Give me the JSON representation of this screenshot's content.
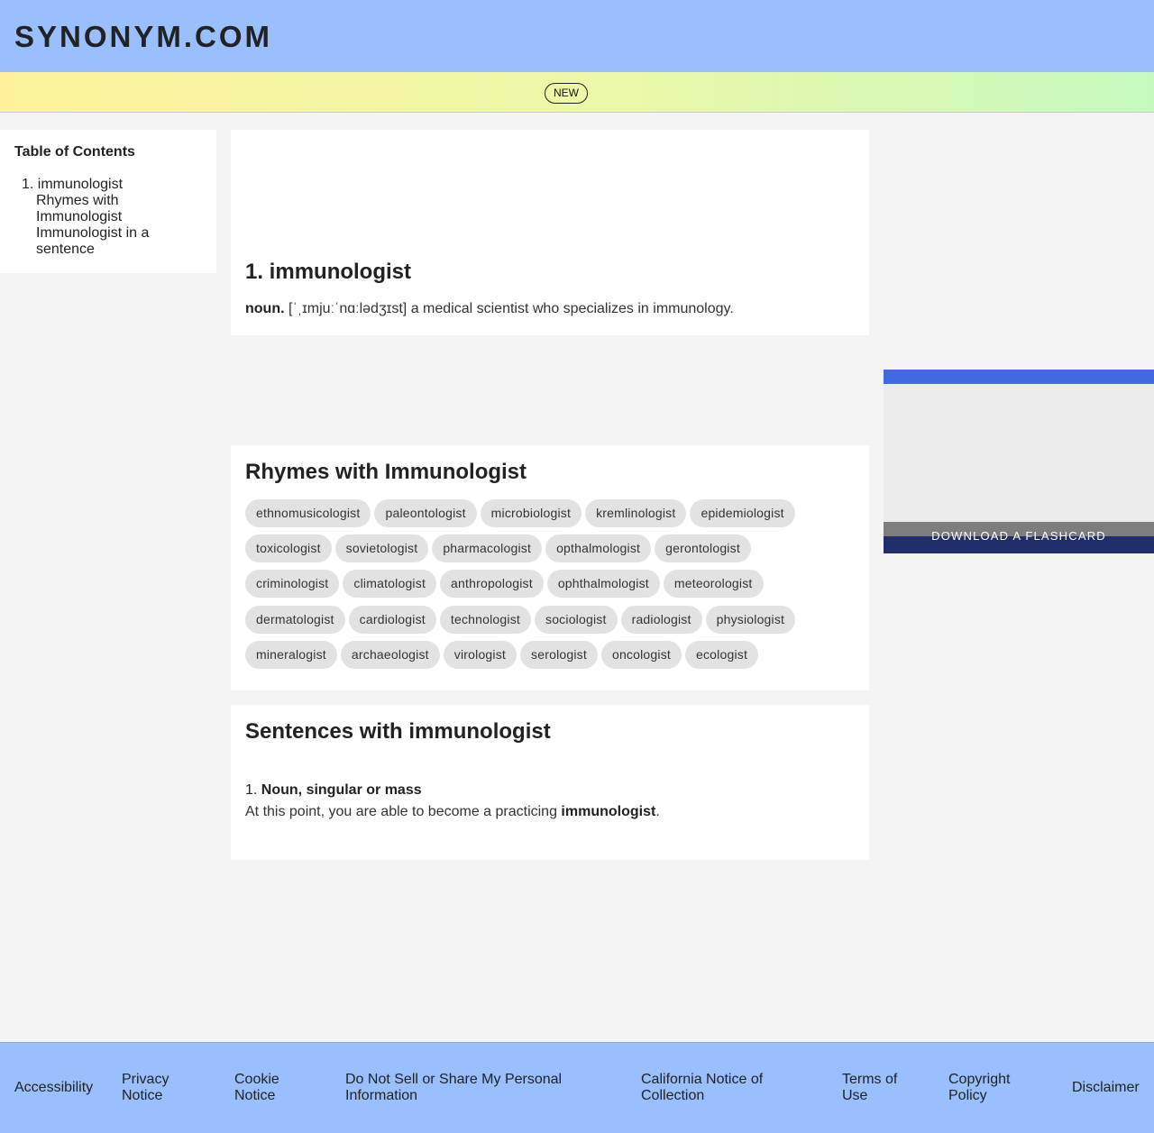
{
  "header": {
    "logo": "SYNONYM.COM"
  },
  "promo": {
    "badge": "NEW"
  },
  "toc": {
    "title": "Table of Contents",
    "main_item": "1. immunologist",
    "sub_items": [
      "Rhymes with Immunologist",
      "Immunologist in a sentence"
    ]
  },
  "definition": {
    "title": "1. immunologist",
    "pos": "noun.",
    "text": "[ˈˌɪmjuːˈnɑːlədʒɪst] a medical scientist who specializes in immunology."
  },
  "rhymes": {
    "title": "Rhymes with Immunologist",
    "rows": [
      [
        "ethnomusicologist",
        "paleontologist",
        "microbiologist",
        "kremlinologist",
        "epidemiologist"
      ],
      [
        "toxicologist",
        "sovietologist",
        "pharmacologist",
        "opthalmologist",
        "gerontologist"
      ],
      [
        "criminologist",
        "climatologist",
        "anthropologist",
        "ophthalmologist",
        "meteorologist"
      ],
      [
        "dermatologist",
        "cardiologist",
        "technologist",
        "sociologist",
        "radiologist",
        "physiologist"
      ],
      [
        "mineralogist",
        "archaeologist",
        "virologist",
        "serologist",
        "oncologist",
        "ecologist"
      ]
    ]
  },
  "sentences": {
    "title": "Sentences with immunologist",
    "number": "1.",
    "pos": "Noun, singular or mass",
    "text_before": "At this point, you are able to become a practicing ",
    "highlight": "immunologist",
    "text_after": "."
  },
  "flashcard": {
    "label": "DOWNLOAD A FLASHCARD"
  },
  "footer": {
    "links": [
      {
        "label": "Accessibility",
        "name": "footer-link-accessibility"
      },
      {
        "label": "Privacy Notice",
        "name": "footer-link-privacy-notice"
      },
      {
        "label": "Cookie Notice",
        "name": "footer-link-cookie-notice"
      },
      {
        "label": "Do Not Sell or Share My Personal Information",
        "name": "footer-link-do-not-sell"
      },
      {
        "label": "California Notice of Collection",
        "name": "footer-link-california-notice"
      },
      {
        "label": "Terms of Use",
        "name": "footer-link-terms-of-use"
      },
      {
        "label": "Copyright Policy",
        "name": "footer-link-copyright-policy"
      },
      {
        "label": "Disclaimer",
        "name": "footer-link-disclaimer"
      }
    ]
  },
  "colors": {
    "header_bg": "#99bfff",
    "footer_bg": "#99bfff",
    "flashcard_accent": "#4169e1",
    "flashcard_dark": "#1f2f6b",
    "chip_bg": "#e2e2e2"
  }
}
